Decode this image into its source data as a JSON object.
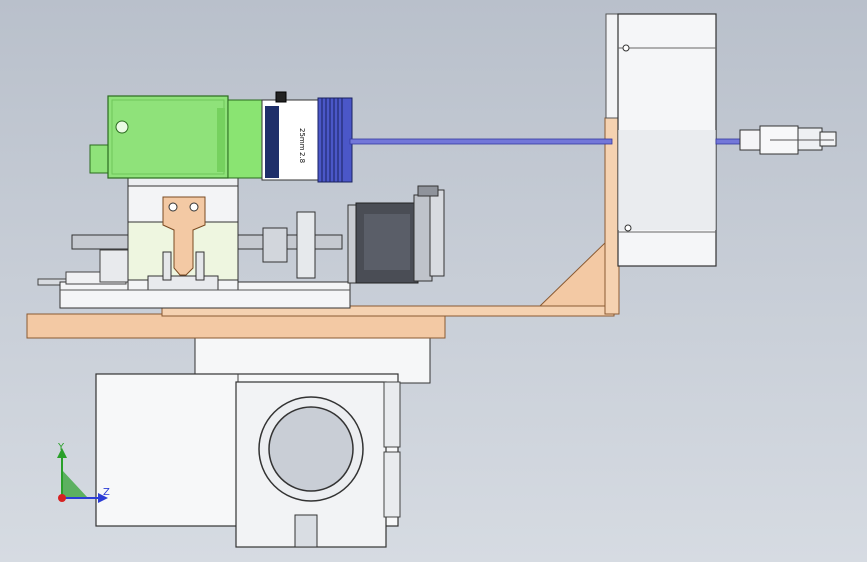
{
  "viewport": {
    "background_top": "#b9c0cb",
    "background_bottom": "#d6dbe2"
  },
  "lens": {
    "focal_label": "25mm",
    "aperture_label": "2.8"
  },
  "triad": {
    "y_label": "Y",
    "z_label": "Z",
    "y_color": "#2aa02a",
    "z_color": "#2b3cd6",
    "x_color": "#d62222"
  },
  "colors": {
    "camera_body": "#8fe27a",
    "lens_blue": "#4b57c8",
    "bracket": "#f3c9a4",
    "motor": "#4a4d55",
    "housing": "#f4f5f7",
    "rod": "#5a5fcf"
  }
}
